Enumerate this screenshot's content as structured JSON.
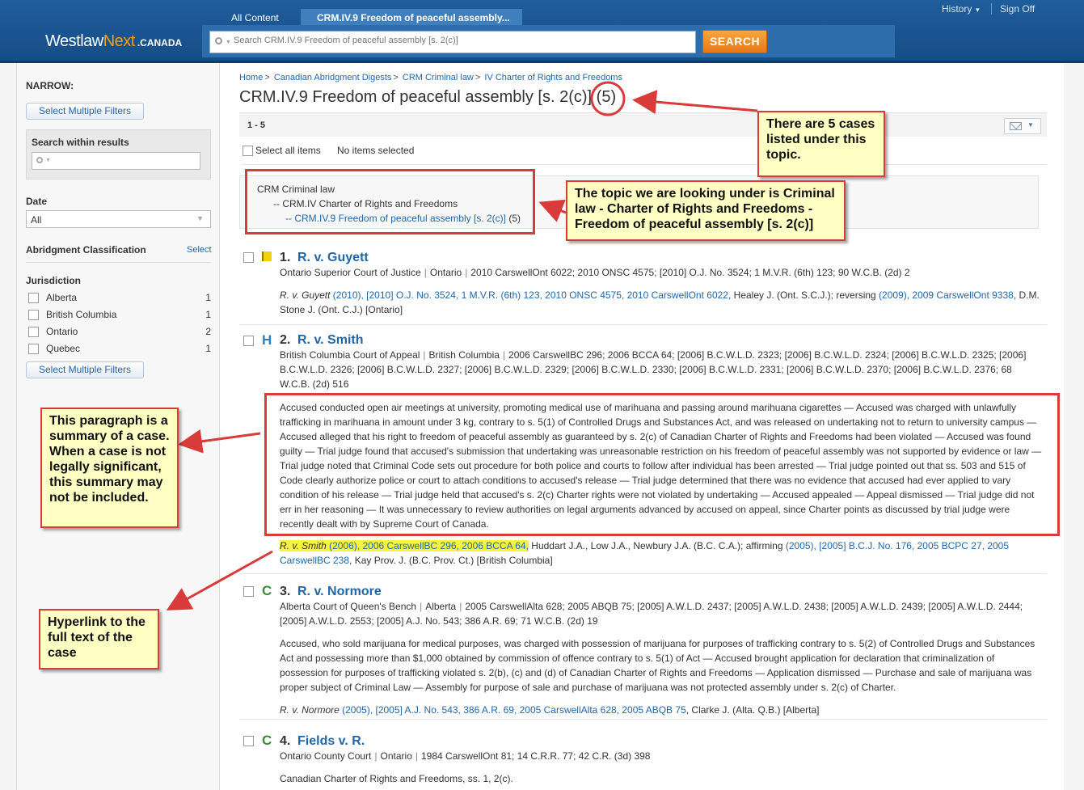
{
  "header": {
    "logo_west": "Westlaw",
    "logo_next": "Next",
    "logo_canada": ".CANADA",
    "tab_all": "All Content",
    "tab_current": "CRM.IV.9 Freedom of peaceful assembly...",
    "search_placeholder": "Search CRM.IV.9 Freedom of peaceful assembly [s. 2(c)]",
    "search_button": "SEARCH",
    "history": "History",
    "sign_off": "Sign Off"
  },
  "sidebar": {
    "narrow": "NARROW:",
    "select_multiple": "Select Multiple Filters",
    "search_within": "Search within results",
    "date_label": "Date",
    "date_value": "All",
    "abridgment_label": "Abridgment Classification",
    "abridgment_select": "Select",
    "jurisdiction_label": "Jurisdiction",
    "jurisdictions": [
      {
        "name": "Alberta",
        "count": "1"
      },
      {
        "name": "British Columbia",
        "count": "1"
      },
      {
        "name": "Ontario",
        "count": "2"
      },
      {
        "name": "Quebec",
        "count": "1"
      }
    ]
  },
  "main": {
    "breadcrumb": [
      "Home",
      "Canadian Abridgment Digests",
      "CRM Criminal law",
      "IV Charter of Rights and Freedoms"
    ],
    "title": "CRM.IV.9 Freedom of peaceful assembly [s. 2(c)]",
    "title_count": "(5)",
    "range": "1 - 5",
    "select_all": "Select all items",
    "no_items": "No items selected",
    "topic": {
      "level1": "CRM Criminal law",
      "level2_prefix": "-- ",
      "level2": "CRM.IV Charter of Rights and Freedoms",
      "level3_link": "-- CRM.IV.9 Freedom of peaceful assembly [s. 2(c)]",
      "level3_count": " (5)"
    },
    "results": [
      {
        "num": "1.",
        "title": "R. v. Guyett",
        "court": "Ontario Superior Court of Justice",
        "jurisdiction": "Ontario",
        "citations": "2010 CarswellOnt 6022; 2010 ONSC 4575; [2010] O.J. No. 3524; 1 M.V.R. (6th) 123; 90 W.C.B. (2d) 2",
        "cite_case": "R. v. Guyett",
        "cite_link1": " (2010), [2010] O.J. No. 3524, 1 M.V.R. (6th) 123, 2010 ONSC 4575, 2010 CarswellOnt 6022",
        "cite_mid": ", Healey J. (Ont. S.C.J.); reversing ",
        "cite_link2": "(2009), 2009 CarswellOnt 9338",
        "cite_end": ", D.M. Stone J. (Ont. C.J.) [Ontario]"
      },
      {
        "num": "2.",
        "badge": "H",
        "title": "R. v. Smith",
        "court": "British Columbia Court of Appeal",
        "jurisdiction": "British Columbia",
        "citations": "2006 CarswellBC 296; 2006 BCCA 64; [2006] B.C.W.L.D. 2323; [2006] B.C.W.L.D. 2324; [2006] B.C.W.L.D. 2325; [2006] B.C.W.L.D. 2326; [2006] B.C.W.L.D. 2327; [2006] B.C.W.L.D. 2329; [2006] B.C.W.L.D. 2330; [2006] B.C.W.L.D. 2331; [2006] B.C.W.L.D. 2370; [2006] B.C.W.L.D. 2376; 68 W.C.B. (2d) 516",
        "summary": "Accused conducted open air meetings at university, promoting medical use of marihuana and passing around marihuana cigarettes — Accused was charged with unlawfully trafficking in marihuana in amount under 3 kg, contrary to s. 5(1) of Controlled Drugs and Substances Act, and was released on undertaking not to return to university campus — Accused alleged that his right to freedom of peaceful assembly as guaranteed by s. 2(c) of Canadian Charter of Rights and Freedoms had been violated — Accused was found guilty — Trial judge found that accused's submission that undertaking was unreasonable restriction on his freedom of peaceful assembly was not supported by evidence or law — Trial judge noted that Criminal Code sets out procedure for both police and courts to follow after individual has been arrested — Trial judge pointed out that ss. 503 and 515 of Code clearly authorize police or court to attach conditions to accused's release — Trial judge determined that there was no evidence that accused had ever applied to vary condition of his release — Trial judge held that accused's s. 2(c) Charter rights were not violated by undertaking — Accused appealed — Appeal dismissed — Trial judge did not err in her reasoning — It was unnecessary to review authorities on legal arguments advanced by accused on appeal, since Charter points as discussed by trial judge were recently dealt with by Supreme Court of Canada.",
        "cite_case": "R. v. Smith",
        "cite_link1": " (2006), 2006 CarswellBC 296, 2006 BCCA 64,",
        "cite_mid": " Huddart J.A., Low J.A., Newbury J.A. (B.C. C.A.); affirming ",
        "cite_link2": "(2005), [2005] B.C.J. No. 176, 2005 BCPC 27, 2005 CarswellBC 238",
        "cite_end": ", Kay Prov. J. (B.C. Prov. Ct.) [British Columbia]"
      },
      {
        "num": "3.",
        "badge": "C",
        "title": "R. v. Normore",
        "court": "Alberta Court of Queen's Bench",
        "jurisdiction": "Alberta",
        "citations": "2005 CarswellAlta 628; 2005 ABQB 75; [2005] A.W.L.D. 2437; [2005] A.W.L.D. 2438; [2005] A.W.L.D. 2439; [2005] A.W.L.D. 2444; [2005] A.W.L.D. 2553; [2005] A.J. No. 543; 386 A.R. 69; 71 W.C.B. (2d) 19",
        "summary": "Accused, who sold marijuana for medical purposes, was charged with possession of marijuana for purposes of trafficking contrary to s. 5(2) of Controlled Drugs and Substances Act and possessing more than $1,000 obtained by commission of offence contrary to s. 5(1) of Act — Accused brought application for declaration that criminalization of possession for purposes of trafficking violated s. 2(b), (c) and (d) of Canadian Charter of Rights and Freedoms — Application dismissed — Purchase and sale of marijuana was proper subject of Criminal Law — Assembly for purpose of sale and purchase of marijuana was not protected assembly under s. 2(c) of Charter.",
        "cite_case": "R. v. Normore",
        "cite_link1": " (2005), [2005] A.J. No. 543, 386 A.R. 69, 2005 CarswellAlta 628, 2005 ABQB 75",
        "cite_end": ", Clarke J. (Alta. Q.B.) [Alberta]"
      },
      {
        "num": "4.",
        "badge": "C",
        "title": "Fields v. R.",
        "court": "Ontario County Court",
        "jurisdiction": "Ontario",
        "citations": "1984 CarswellOnt 81; 14 C.R.R. 77; 42 C.R. (3d) 398",
        "summary": "Canadian Charter of Rights and Freedoms, ss. 1, 2(c)."
      }
    ]
  },
  "annotations": {
    "count_note": "There are 5 cases listed under this topic.",
    "topic_note": "The topic we are looking under is Criminal law - Charter of Rights and Freedoms - Freedom of peaceful assembly [s. 2(c)]",
    "summary_note": "This paragraph is a summary of a case. When a case is not legally significant, this summary may not be included.",
    "hyperlink_note": "Hyperlink to the full text of the case",
    "accent_color": "#d93a3a",
    "note_bg": "#ffffc4"
  }
}
